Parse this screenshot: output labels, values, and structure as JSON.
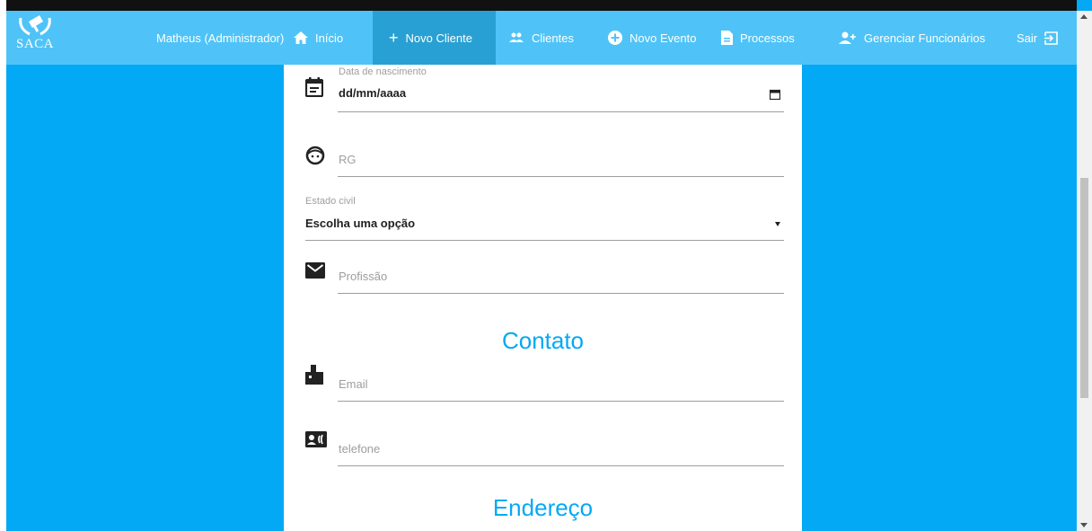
{
  "app": {
    "logo_text": "SACA"
  },
  "nav": {
    "user": "Matheus (Administrador)",
    "inicio": "Início",
    "novo_cliente": "Novo Cliente",
    "clientes": "Clientes",
    "novo_evento": "Novo Evento",
    "processos": "Processos",
    "gerenciar": "Gerenciar Funcionários",
    "sair": "Sair"
  },
  "form": {
    "data_nascimento": {
      "label": "Data de nascimento",
      "value": "dd/mm/aaaa"
    },
    "rg": {
      "placeholder": "RG"
    },
    "estado_civil": {
      "label": "Estado civil",
      "value": "Escolha uma opção"
    },
    "profissao": {
      "placeholder": "Profissão"
    },
    "contato_title": "Contato",
    "email": {
      "placeholder": "Email"
    },
    "telefone": {
      "placeholder": "telefone"
    },
    "endereco_title": "Endereço"
  },
  "colors": {
    "accent": "#03A9F4",
    "navbar": "#4FC3F7",
    "active": "#29A0D3"
  }
}
